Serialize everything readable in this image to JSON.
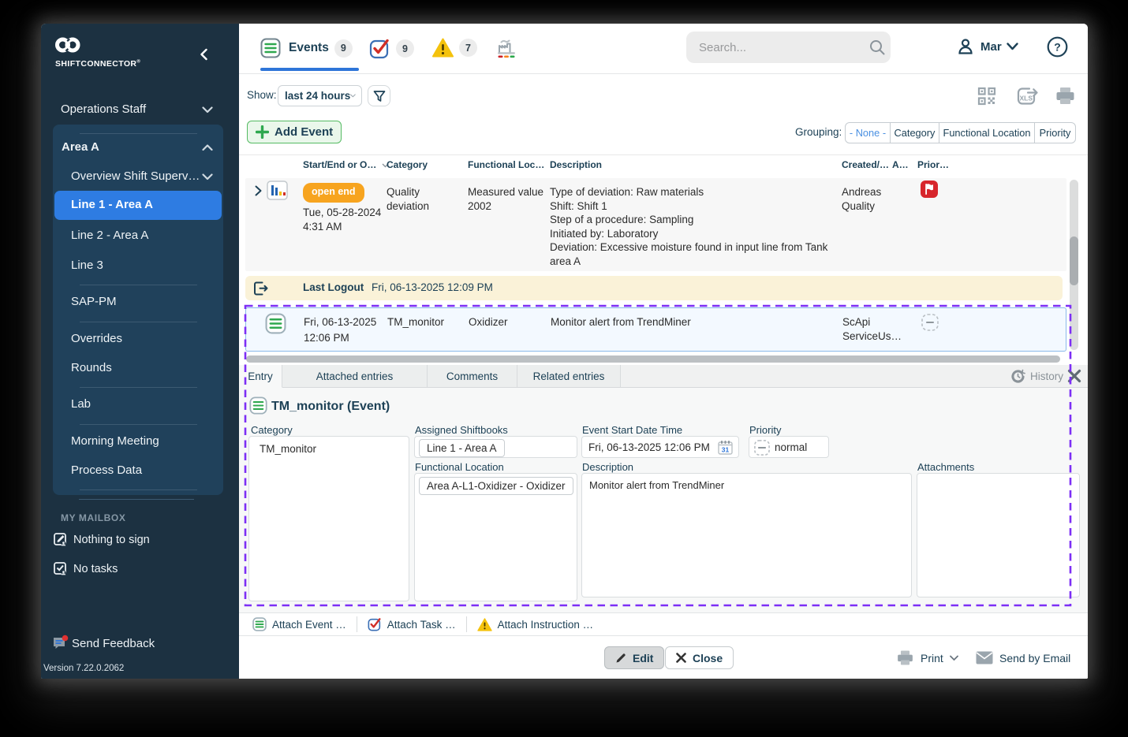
{
  "sidebar": {
    "brand": "SHIFTCONNECTOR",
    "brand_reg": "®",
    "top_item": {
      "label": "Operations Staff"
    },
    "group": {
      "header": "Area A",
      "items": [
        {
          "label": "Overview Shift Superv…"
        },
        {
          "label": "Line 1 - Area A",
          "selected": true
        },
        {
          "label": "Line 2 - Area A"
        },
        {
          "label": "Line 3"
        },
        {
          "label": "SAP-PM"
        },
        {
          "label": "Overrides"
        },
        {
          "label": "Rounds"
        },
        {
          "label": "Lab"
        },
        {
          "label": "Morning Meeting"
        },
        {
          "label": "Process Data"
        }
      ]
    },
    "mailbox": {
      "header": "MY MAILBOX",
      "items": [
        {
          "label": "Nothing to sign"
        },
        {
          "label": "No tasks"
        }
      ]
    },
    "feedback_label": "Send Feedback",
    "version": "Version 7.22.0.2062"
  },
  "topbar": {
    "tabs": [
      {
        "label": "Events",
        "badge": "9",
        "icon": "event-list"
      },
      {
        "badge": "9",
        "icon": "task-check"
      },
      {
        "badge": "7",
        "icon": "warning-triangle"
      },
      {
        "icon": "factory-trend"
      }
    ],
    "search_placeholder": "Search...",
    "user_name": "Mar"
  },
  "toolbar": {
    "show_label": "Show:",
    "range_value": "last 24 hours"
  },
  "actions": {
    "add_event_label": "Add Event",
    "grouping_label": "Grouping:",
    "grouping_options": [
      "- None -",
      "Category",
      "Functional Location",
      "Priority"
    ],
    "grouping_selected": "- None -"
  },
  "table": {
    "columns": [
      "Start/End or O…",
      "Category",
      "Functional Loc…",
      "Description",
      "Created/…",
      "A…",
      "Prior…"
    ],
    "row1": {
      "status_badge": "open end",
      "start_date": "Tue, 05-28-2024",
      "start_time": "4:31 AM",
      "category": "Quality deviation",
      "functional_location": "Measured value 2002",
      "description": "Type of deviation: Raw materials\nShift: Shift 1\nStep of a procedure: Sampling\nInitiated by: Laboratory\nDeviation: Excessive moisture found in input line from Tank area A",
      "created_by": "Andreas Quality",
      "priority_icon": "red-flag"
    },
    "logout_row": {
      "label": "Last Logout",
      "timestamp": "Fri, 06-13-2025 12:09 PM"
    },
    "selected_row": {
      "start_date": "Fri, 06-13-2025",
      "start_time": "12:06 PM",
      "category": "TM_monitor",
      "functional_location": "Oxidizer",
      "description": "Monitor alert from TrendMiner",
      "created_by": "ScApi ServiceUs…",
      "priority_icon": "none-dashed"
    }
  },
  "detail": {
    "tabs": [
      "Entry",
      "Attached entries",
      "Comments",
      "Related entries"
    ],
    "active_tab": "Entry",
    "history_label": "History",
    "title": "TM_monitor (Event)",
    "fields": {
      "category": {
        "label": "Category",
        "value": "TM_monitor"
      },
      "assigned_shiftbooks": {
        "label": "Assigned Shiftbooks",
        "value": "Line 1 - Area A"
      },
      "event_start": {
        "label": "Event Start Date Time",
        "value": "Fri, 06-13-2025 12:06 PM",
        "calendar_day": "31"
      },
      "priority": {
        "label": "Priority",
        "value": "normal"
      },
      "functional_location": {
        "label": "Functional Location",
        "value": "Area A-L1-Oxidizer - Oxidizer"
      },
      "description": {
        "label": "Description",
        "value": "Monitor alert from TrendMiner"
      },
      "attachments": {
        "label": "Attachments",
        "value": ""
      }
    }
  },
  "attach_actions": [
    {
      "label": "Attach Event …",
      "icon": "event-list"
    },
    {
      "label": "Attach Task …",
      "icon": "task-check"
    },
    {
      "label": "Attach Instruction …",
      "icon": "warning-triangle"
    }
  ],
  "footer": {
    "edit_label": "Edit",
    "close_label": "Close",
    "print_label": "Print",
    "send_by_email_label": "Send by Email"
  },
  "colors": {
    "accent_blue": "#2E75D8",
    "selected_item_blue": "#2E7CE2",
    "green": "#2FA84F",
    "orange_badge": "#F7A41F",
    "red": "#D7262C",
    "warning_yellow": "#F4C20D",
    "selection_purple": "#7D2FF5",
    "navy_text": "#1D4156",
    "logout_cream": "#FAF2D8",
    "sidebar_bg": "#1C3141",
    "sidebar_panel_bg": "#20415B"
  }
}
